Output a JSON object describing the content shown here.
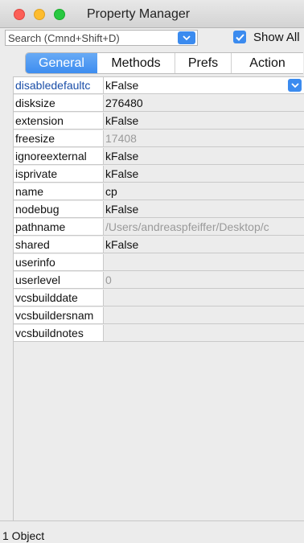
{
  "window": {
    "title": "Property Manager"
  },
  "search": {
    "placeholder": "Search (Cmnd+Shift+D)",
    "value": ""
  },
  "show_all": {
    "label": "Show All",
    "checked": true
  },
  "tabs": [
    {
      "label": "General",
      "active": true
    },
    {
      "label": "Methods",
      "active": false
    },
    {
      "label": "Prefs",
      "active": false
    },
    {
      "label": "Action",
      "active": false
    }
  ],
  "properties": [
    {
      "name": "disabledefaultc",
      "value": "kFalse",
      "selected": true
    },
    {
      "name": "disksize",
      "value": "276480"
    },
    {
      "name": "extension",
      "value": "kFalse"
    },
    {
      "name": "freesize",
      "value": "17408",
      "dim": true
    },
    {
      "name": "ignoreexternal",
      "value": "kFalse"
    },
    {
      "name": "isprivate",
      "value": "kFalse"
    },
    {
      "name": "name",
      "value": "cp"
    },
    {
      "name": "nodebug",
      "value": "kFalse"
    },
    {
      "name": "pathname",
      "value": "/Users/andreaspfeiffer/Desktop/c",
      "dim": true
    },
    {
      "name": "shared",
      "value": "kFalse"
    },
    {
      "name": "userinfo",
      "value": ""
    },
    {
      "name": "userlevel",
      "value": "0",
      "dim": true
    },
    {
      "name": "vcsbuilddate",
      "value": ""
    },
    {
      "name": "vcsbuildersnam",
      "value": ""
    },
    {
      "name": "vcsbuildnotes",
      "value": ""
    }
  ],
  "status": {
    "text": "1 Object"
  },
  "colors": {
    "accent": "#3b8bef",
    "selected_name": "#1a4ea8",
    "dim_value": "#9a9a9a"
  },
  "icons": {
    "dropdown": "chevron-down-icon",
    "checkbox": "checkmark-icon"
  }
}
